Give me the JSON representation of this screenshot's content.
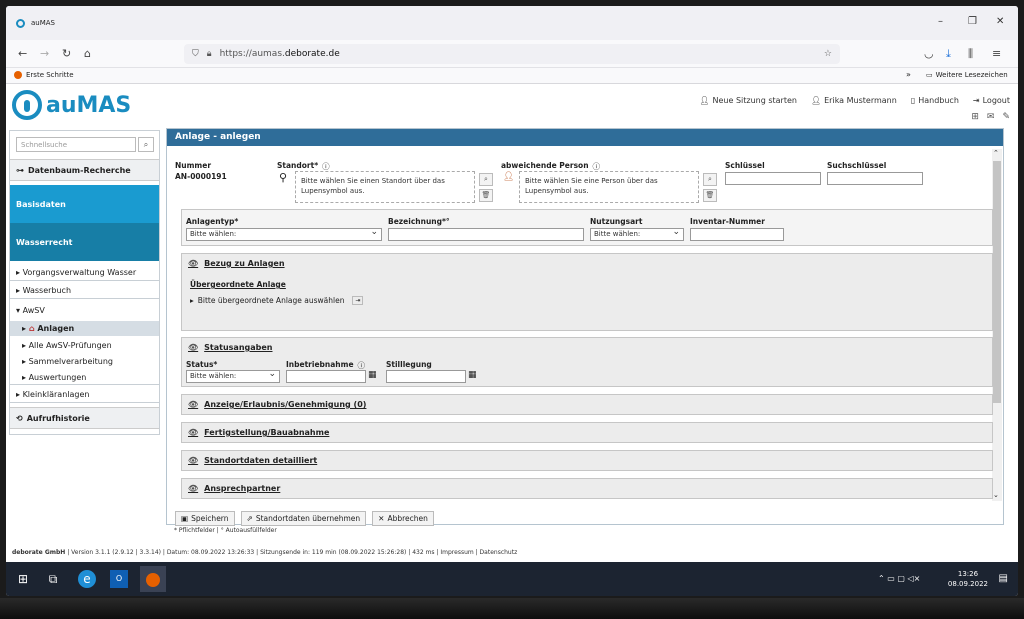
{
  "browser": {
    "tab_title": "auMAS",
    "url_prefix": "https://aumas.",
    "url_domain": "deborate.de",
    "bookmark_first": "Erste Schritte",
    "bookmark_more": "Weitere Lesezeichen"
  },
  "header": {
    "logo": "auMAS",
    "new_session": "Neue Sitzung starten",
    "user": "Erika Mustermann",
    "manual": "Handbuch",
    "logout": "Logout"
  },
  "sidebar": {
    "search_placeholder": "Schnellsuche",
    "datenbaum": "Datenbaum-Recherche",
    "basisdaten": "Basisdaten",
    "wasserrecht": "Wasserrecht",
    "items": [
      "Vorgangsverwaltung Wasser",
      "Wasserbuch",
      "AwSV",
      "Anlagen",
      "Alle AwSV-Prüfungen",
      "Sammelverarbeitung",
      "Auswertungen",
      "Kleinkläranlagen"
    ],
    "history": "Aufrufhistorie"
  },
  "form": {
    "title": "Anlage - anlegen",
    "nummer_label": "Nummer",
    "nummer_value": "AN-0000191",
    "standort_label": "Standort*",
    "standort_hint": "Bitte wählen Sie einen Standort über das Lupensymbol aus.",
    "person_label": "abweichende Person",
    "person_hint": "Bitte wählen Sie eine Person über das Lupensymbol aus.",
    "schluessel_label": "Schlüssel",
    "suchschluessel_label": "Suchschlüssel",
    "anlagentyp_label": "Anlagentyp*",
    "anlagentyp_value": "Bitte wählen:",
    "bezeichnung_label": "Bezeichnung*°",
    "nutzungsart_label": "Nutzungsart",
    "nutzungsart_value": "Bitte wählen:",
    "inventar_label": "Inventar-Nummer",
    "bezug_title": "Bezug zu Anlagen",
    "uebergeordnet_title": "Übergeordnete Anlage",
    "uebergeordnet_hint": "Bitte übergeordnete Anlage auswählen",
    "status_title": "Statusangaben",
    "status_label": "Status*",
    "status_value": "Bitte wählen:",
    "inbetrieb_label": "Inbetriebnahme",
    "stilllegung_label": "Stilllegung",
    "anzeige_title": "Anzeige/Erlaubnis/Genehmigung (0)",
    "fertig_title": "Fertigstellung/Bauabnahme",
    "standortdaten_title": "Standortdaten detailliert",
    "ansprech_title": "Ansprechpartner",
    "save_label": "Speichern",
    "take_label": "Standortdaten übernehmen",
    "cancel_label": "Abbrechen",
    "note": "* Pflichtfelder  | ° Autoausfüllfelder"
  },
  "footer": {
    "company": "deborate GmbH",
    "text": " | Version 3.1.1 (2.9.12 | 3.3.14) | Datum: 08.09.2022 13:26:33 | Sitzungsende in: 119 min (08.09.2022 15:26:28) | 432 ms | Impressum | Datenschutz"
  },
  "taskbar": {
    "time": "13:26",
    "date": "08.09.2022"
  },
  "colors": {
    "brand": "#1a8cc0",
    "title_bar": "#2f6d99",
    "basisdaten": "#1a9bd0",
    "wasserrecht": "#177ea6"
  }
}
